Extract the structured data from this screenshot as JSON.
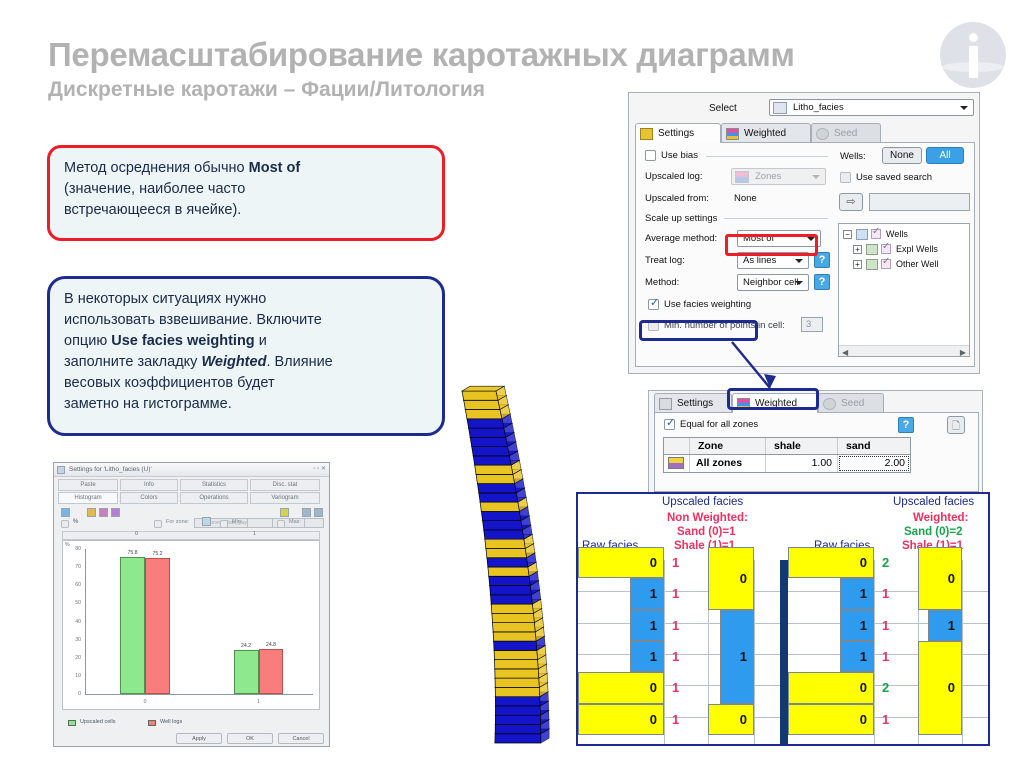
{
  "title": {
    "main": "Перемасштабирование каротажных диаграмм",
    "sub": "Дискретные каротажи – Фации/Литология"
  },
  "info_icon": {
    "name": "info-icon"
  },
  "callouts": {
    "red": {
      "line1_a": "Метод осреднения обычно ",
      "line1_b": "Most of",
      "line2": "(значение, наиболее часто",
      "line3": "встречающееся в ячейке)."
    },
    "blue": {
      "line1": "В некоторых ситуациях нужно",
      "line2": "использовать взвешивание. Включите",
      "line3_a": "опцию ",
      "line3_b": "Use facies weighting",
      "line3_c": " и",
      "line4_a": "заполните закладку ",
      "line4_b": "Weighted",
      "line4_c": ". Влияние",
      "line5": "весовых коэффициентов будет",
      "line6": "заметно на гистограмме."
    }
  },
  "settings_dialog": {
    "select_label": "Select",
    "select_value": "Litho_facies",
    "tabs": [
      {
        "label": "Settings",
        "state": "active"
      },
      {
        "label": "Weighted",
        "state": "inactive"
      },
      {
        "label": "Seed",
        "state": "disabled"
      }
    ],
    "use_bias": {
      "label": "Use bias",
      "checked": false
    },
    "upscaled_log": {
      "label": "Upscaled log:",
      "value": "Zones"
    },
    "upscaled_from": {
      "label": "Upscaled from:",
      "value": "None"
    },
    "scale_up_settings": "Scale up settings",
    "average_method": {
      "label": "Average method:",
      "value": "Most of"
    },
    "treat_log": {
      "label": "Treat log:",
      "value": "As lines"
    },
    "method": {
      "label": "Method:",
      "value": "Neighbor cell"
    },
    "use_facies_weighting": {
      "label": "Use facies weighting",
      "checked": true
    },
    "min_points": {
      "label": "Min. number of points in cell:",
      "value": "3",
      "checked": false
    },
    "wells": {
      "label": "Wells:",
      "none_button": "None",
      "all_button": "All",
      "use_saved_search": {
        "label": "Use saved search",
        "checked": false
      },
      "search_value": "",
      "tree": [
        {
          "label": "Wells",
          "level": 0
        },
        {
          "label": "Expl Wells",
          "level": 1
        },
        {
          "label": "Other Well",
          "level": 1
        }
      ]
    },
    "help_glyph": "?"
  },
  "weighted_dialog": {
    "tabs": [
      {
        "label": "Settings",
        "state": "inactive"
      },
      {
        "label": "Weighted",
        "state": "active"
      },
      {
        "label": "Seed",
        "state": "disabled"
      }
    ],
    "equal_for_all_zones": {
      "label": "Equal for all zones",
      "checked": true
    },
    "help_glyph": "?",
    "table": {
      "headers": [
        "Zone",
        "shale",
        "sand"
      ],
      "rows": [
        {
          "zone": "All zones",
          "shale": "1.00",
          "sand": "2.00"
        }
      ]
    }
  },
  "facies_panel": {
    "left": {
      "raw_label": "Raw facies",
      "upscaled_label": "Upscaled facies",
      "mode_label": "Non Weighted:",
      "sand_weight": "Sand (0)=1",
      "shale_weight": "Shale (1)=1",
      "raw_cells": [
        "0",
        "1",
        "1",
        "1",
        "0",
        "0"
      ],
      "raw_types": [
        "sand",
        "shale",
        "shale",
        "shale",
        "sand",
        "sand"
      ],
      "weights": [
        "1",
        "1",
        "1",
        "1",
        "1",
        "1"
      ],
      "weight_colors": [
        "r",
        "r",
        "r",
        "r",
        "r",
        "r"
      ],
      "upscaled_cells": [
        {
          "value": "0",
          "type": "sand",
          "start": 0,
          "span": 2
        },
        {
          "value": "1",
          "type": "shale",
          "start": 2,
          "span": 3
        },
        {
          "value": "0",
          "type": "sand",
          "start": 5,
          "span": 1
        }
      ]
    },
    "right": {
      "raw_label": "Raw facies",
      "upscaled_label": "Upscaled facies",
      "mode_label": "Weighted:",
      "sand_weight": "Sand (0)=2",
      "shale_weight": "Shale (1)=1",
      "raw_cells": [
        "0",
        "1",
        "1",
        "1",
        "0",
        "0"
      ],
      "raw_types": [
        "sand",
        "shale",
        "shale",
        "shale",
        "sand",
        "sand"
      ],
      "weights": [
        "2",
        "1",
        "1",
        "1",
        "2",
        "1"
      ],
      "weight_colors": [
        "g",
        "r",
        "r",
        "r",
        "g",
        "r"
      ],
      "upscaled_cells": [
        {
          "value": "0",
          "type": "sand",
          "start": 0,
          "span": 2
        },
        {
          "value": "1",
          "type": "shale",
          "start": 2,
          "span": 1
        },
        {
          "value": "0",
          "type": "sand",
          "start": 3,
          "span": 3
        }
      ]
    }
  },
  "histogram_window": {
    "title": "Settings for 'Litho_facies (U)'",
    "tabs_row1": [
      "Paste",
      "Info",
      "Statistics",
      "Disc. stat"
    ],
    "tabs_row2": [
      "Histogram",
      "Colors",
      "Operations",
      "Variogram"
    ],
    "for_zone_label": "For zone:",
    "for_zone_value": "Zones (Main_pay)",
    "percent_label": "%",
    "min_label": "Min:",
    "max_label": "Max:",
    "buttons": [
      "Apply",
      "OK",
      "Cancel"
    ],
    "legend": [
      "Upscaled cells",
      "Well logs"
    ]
  },
  "chart_data": {
    "type": "bar",
    "title": "",
    "categories": [
      "0",
      "1"
    ],
    "series": [
      {
        "name": "Upscaled cells",
        "values": [
          75.8,
          24.2
        ],
        "color": "#8ee88e"
      },
      {
        "name": "Well logs",
        "values": [
          75.2,
          24.8
        ],
        "color": "#f97d7d"
      }
    ],
    "xlabel": "",
    "ylabel": "%",
    "ylim": [
      0,
      80
    ],
    "yticks": [
      0,
      10,
      20,
      30,
      40,
      50,
      60,
      70,
      80
    ],
    "grid": false,
    "legend_position": "bottom-left"
  },
  "log3d": {
    "name": "upscaled-log-column",
    "sand_color": "#e8c423",
    "shale_color": "#1414c8",
    "layers": [
      "sand",
      "sand",
      "sand",
      "shale",
      "shale",
      "shale",
      "shale",
      "shale",
      "sand",
      "sand",
      "shale",
      "shale",
      "sand",
      "shale",
      "shale",
      "shale",
      "sand",
      "sand",
      "shale",
      "sand",
      "shale",
      "shale",
      "shale",
      "sand",
      "sand",
      "sand",
      "sand",
      "shale",
      "sand",
      "sand",
      "sand",
      "sand",
      "sand",
      "shale",
      "shale",
      "shale",
      "shale",
      "shale"
    ]
  },
  "colors": {
    "accent_red": "#ee1c24",
    "accent_blue": "#1d2a8f",
    "sand": "#ffff00",
    "shale": "#2e9bef",
    "weight_red": "#f0325f",
    "weight_green": "#17a34a"
  }
}
